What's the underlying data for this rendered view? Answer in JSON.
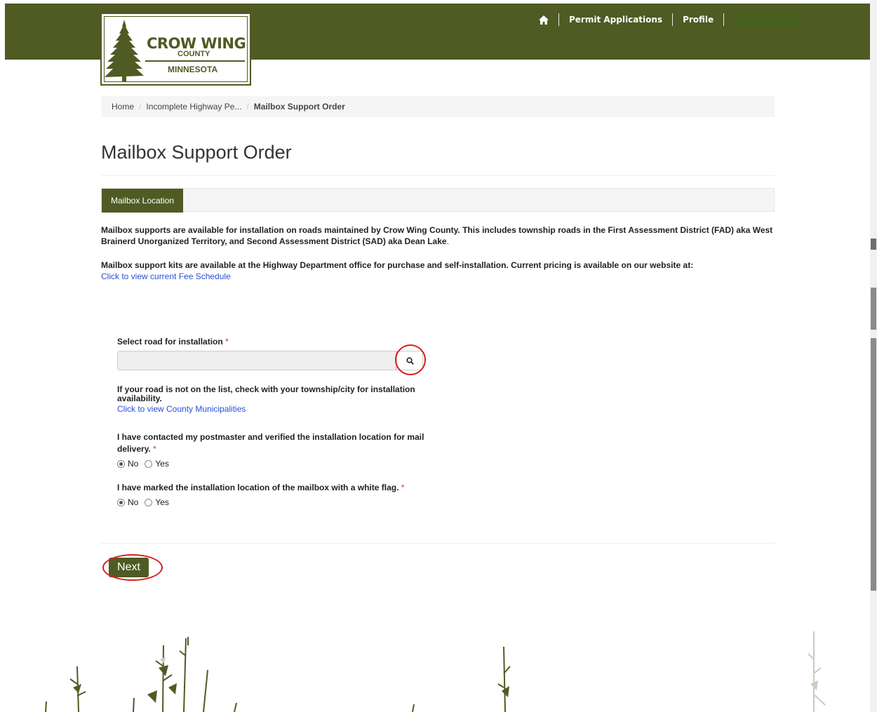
{
  "header": {
    "logo": {
      "line1": "CROW WING",
      "line2": "COUNTY",
      "line3": "MINNESOTA"
    },
    "nav": {
      "home_icon": "home-icon",
      "items": [
        "Permit Applications",
        "Profile"
      ]
    }
  },
  "breadcrumb": {
    "items": [
      "Home",
      "Incomplete Highway Pe...",
      "Mailbox Support Order"
    ]
  },
  "page": {
    "title": "Mailbox Support Order",
    "tab_active": "Mailbox Location"
  },
  "intro": {
    "para1_bold": "Mailbox supports are available for installation on roads maintained by Crow Wing County. This includes township roads in the First Assessment District (FAD) aka West Brainerd Unorganized Territory, and Second Assessment District (SAD) aka Dean Lake",
    "para1_end": ".",
    "para2_bold": "Mailbox support kits are available at the Highway Department office for purchase and self-installation. Current pricing is available on our website at:",
    "fee_link": "Click to view current Fee Schedule"
  },
  "form": {
    "road": {
      "label": "Select road for installation",
      "required": "*",
      "value": "",
      "search_icon": "search-icon",
      "help": "If your road is not on the list, check with your township/city for installation availability.",
      "help_link": "Click to view County Municipalities"
    },
    "postmaster": {
      "label_line1": "I have contacted my postmaster and verified the installation location for mail",
      "label_line2": "delivery.",
      "required": "*",
      "options": [
        "No",
        "Yes"
      ],
      "selected": "No"
    },
    "flag": {
      "label": "I have marked the installation location of the mailbox with a white flag.",
      "required": "*",
      "options": [
        "No",
        "Yes"
      ],
      "selected": "No"
    },
    "next_label": "Next"
  },
  "colors": {
    "brand_green": "#4f5b23",
    "annotation_red": "#d81e1e",
    "link_blue": "#2a4fd8"
  }
}
